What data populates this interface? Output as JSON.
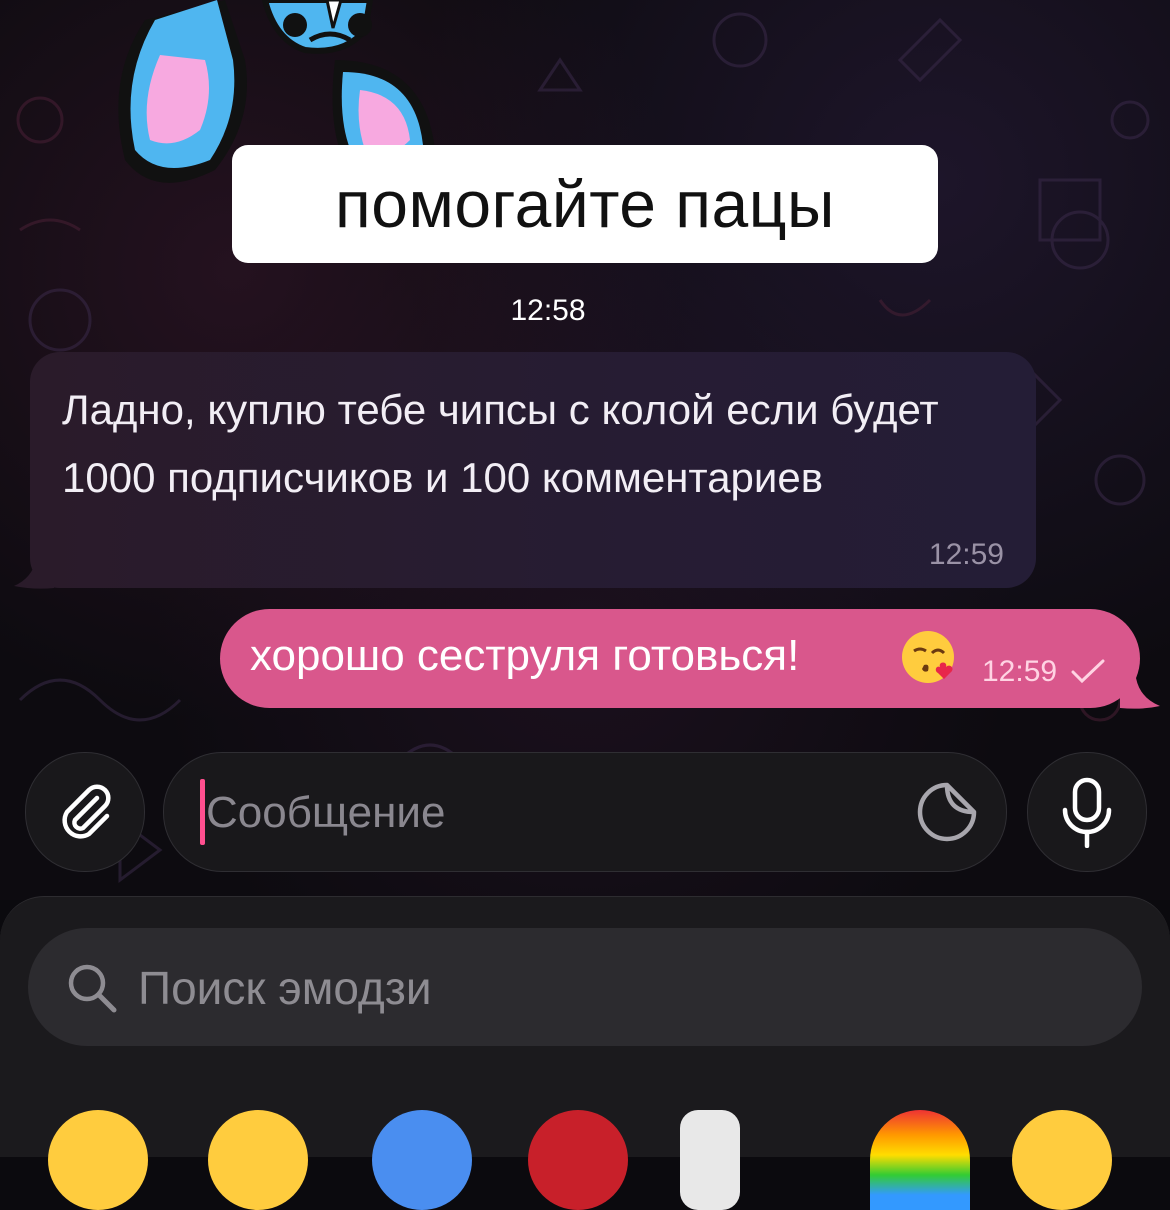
{
  "sticker": {
    "caption": "помогайте пацы",
    "time": "12:58"
  },
  "messages": [
    {
      "direction": "incoming",
      "text": "Ладно, куплю тебе чипсы с колой если будет 1000 подписчиков и 100 комментариев",
      "time": "12:59"
    },
    {
      "direction": "outgoing",
      "text": "хорошо сеструля готовься!",
      "emoji": "face-blowing-kiss",
      "time": "12:59",
      "status": "sent"
    }
  ],
  "composer": {
    "placeholder": "Сообщение",
    "attach_icon": "paperclip-icon",
    "sticker_icon": "sticker-icon",
    "mic_icon": "microphone-icon"
  },
  "emoji_panel": {
    "search_placeholder": "Поиск эмодзи"
  },
  "colors": {
    "outgoing_bubble": "#d9578c",
    "incoming_bubble": "#271c31",
    "caret": "#ff4f8f"
  }
}
